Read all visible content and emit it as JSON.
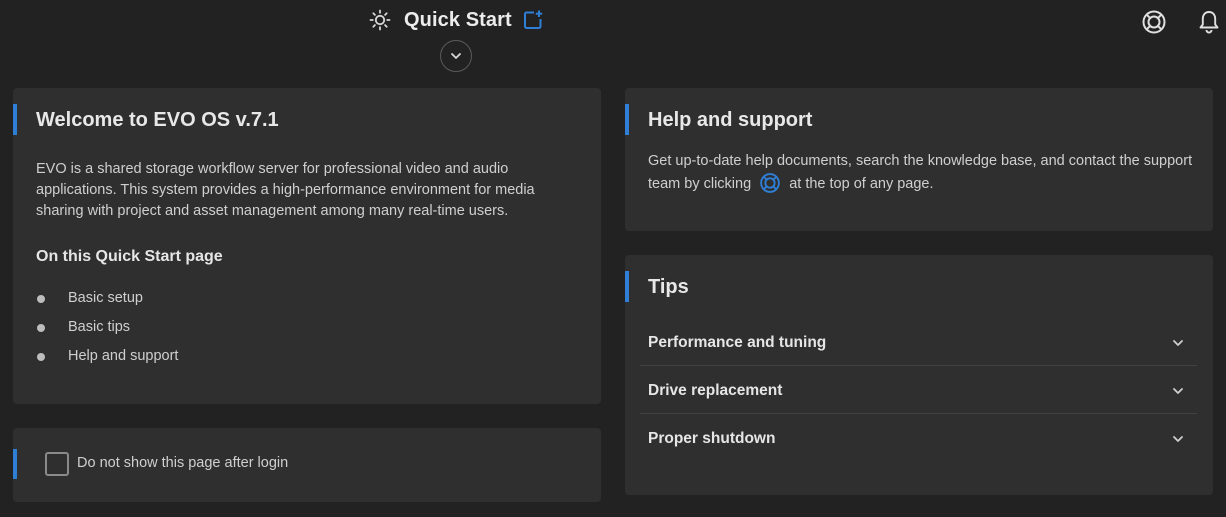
{
  "header": {
    "title": "Quick Start",
    "icons": {
      "page": "sun-icon",
      "share": "share-icon",
      "collapse": "chevron-down-icon",
      "help": "lifebuoy-icon",
      "notifications": "bell-icon"
    }
  },
  "welcome": {
    "title": "Welcome to EVO OS v.7.1",
    "description": "EVO is a shared storage workflow server for professional video and audio applications. This system provides a high-performance environment for media sharing with project and asset management among many real-time users.",
    "subtitle": "On this Quick Start page",
    "items": [
      {
        "label": "Basic setup"
      },
      {
        "label": "Basic tips"
      },
      {
        "label": "Help and support"
      }
    ]
  },
  "dont_show": {
    "label": "Do not show this page after login",
    "checked": false
  },
  "help_support": {
    "title": "Help and support",
    "text_before": "Get up-to-date help documents, search the knowledge base, and contact the support team by clicking",
    "text_after": "at the top of any page."
  },
  "tips": {
    "title": "Tips",
    "items": [
      {
        "label": "Performance and tuning"
      },
      {
        "label": "Drive replacement"
      },
      {
        "label": "Proper shutdown"
      }
    ]
  },
  "colors": {
    "accent": "#2f7fd6",
    "background": "#222222",
    "panel": "#2f2f2f"
  }
}
